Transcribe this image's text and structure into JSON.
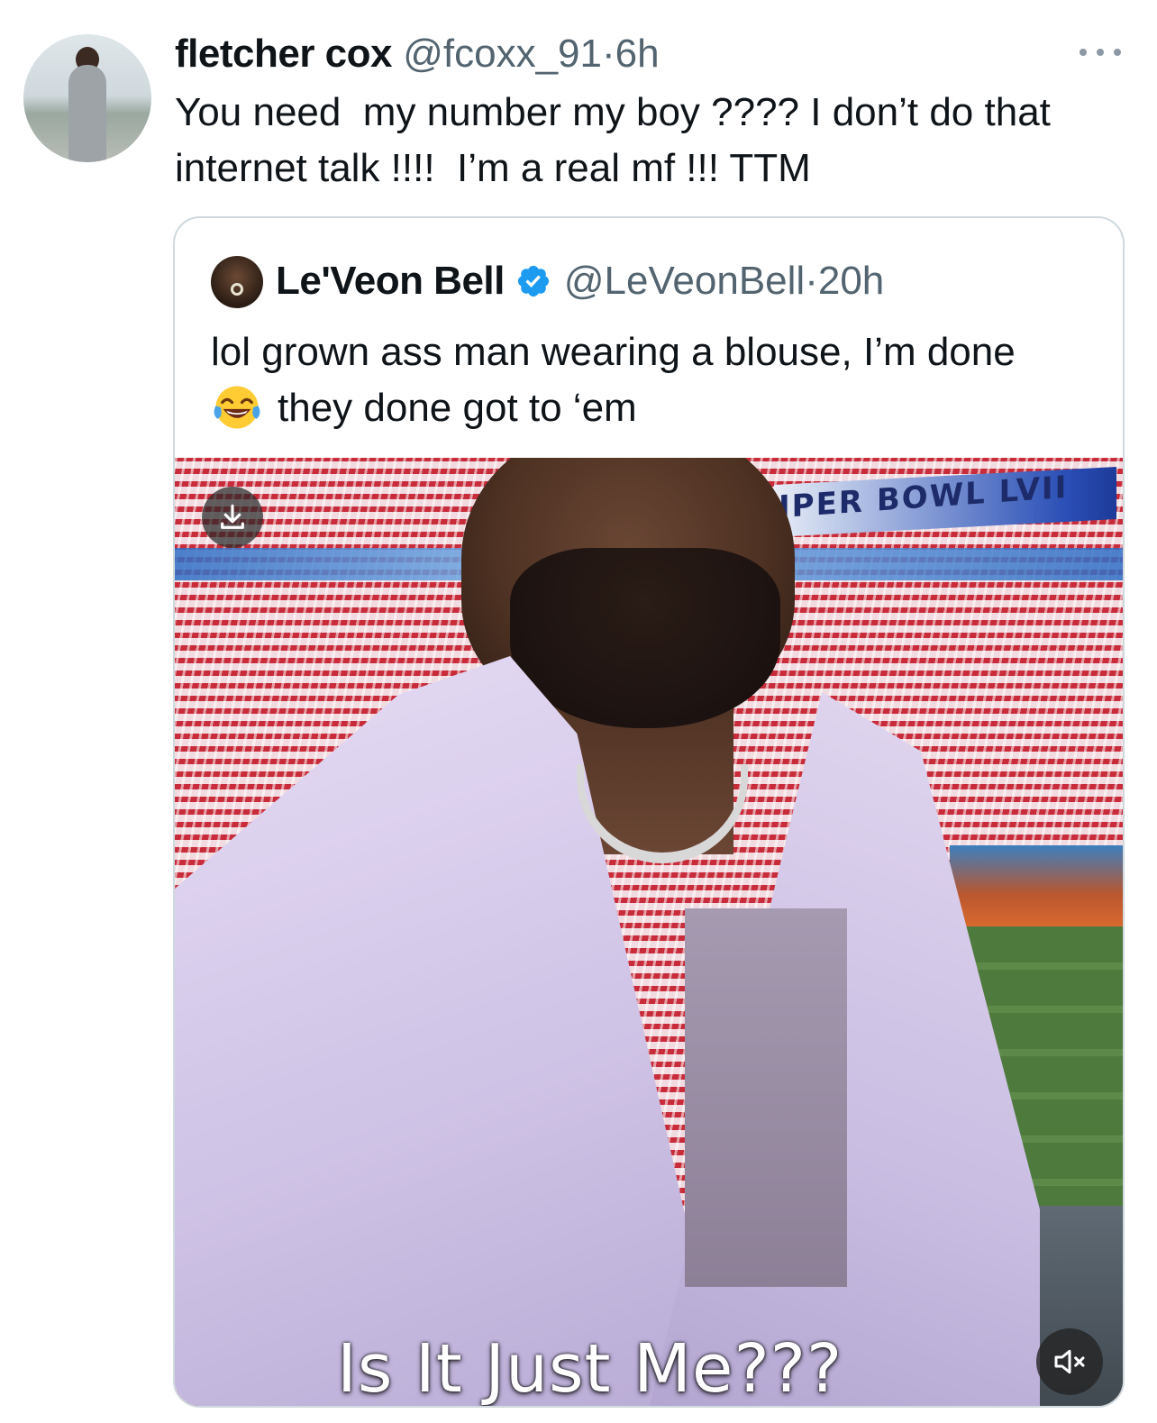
{
  "tweet": {
    "display_name": "fletcher cox",
    "handle": "@fcoxx_91",
    "separator": "·",
    "time": "6h",
    "text": "You need  my number my boy ???? I don’t do that internet talk !!!!  I’m a real mf !!! TTM",
    "more_icon": "ellipsis-icon"
  },
  "quoted": {
    "display_name": "Le'Veon Bell",
    "verified": true,
    "verified_color": "#1d9bf0",
    "handle": "@LeVeonBell",
    "separator": "·",
    "time": "20h",
    "text_line1": "lol grown ass man wearing a blouse, I’m done",
    "text_line2": "they done got to ‘em",
    "emoji": "face-with-tears-of-joy",
    "media": {
      "type": "video",
      "banner_text": "IPER BOWL LVII",
      "caption": "Is It Just Me???",
      "download_icon": "download-icon",
      "mute_icon": "speaker-muted-icon"
    }
  },
  "colors": {
    "primary_text": "#0f1419",
    "secondary_text": "#536471",
    "border": "#cfd9de",
    "verified": "#1d9bf0"
  }
}
